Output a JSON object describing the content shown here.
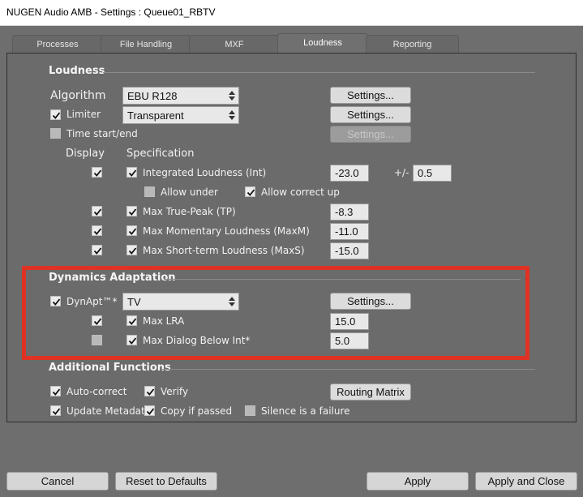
{
  "window": {
    "title": "NUGEN Audio AMB - Settings : Queue01_RBTV"
  },
  "tabs": [
    {
      "label": "Processes",
      "active": false
    },
    {
      "label": "File Handling",
      "active": false
    },
    {
      "label": "MXF",
      "active": false
    },
    {
      "label": "Loudness",
      "active": true
    },
    {
      "label": "Reporting",
      "active": false
    }
  ],
  "loudness": {
    "heading": "Loudness",
    "algorithm_label": "Algorithm",
    "algorithm_value": "EBU R128",
    "limiter_label": "Limiter",
    "limiter_checked": true,
    "limiter_value": "Transparent",
    "time_label": "Time start/end",
    "time_checked": false,
    "settings_label": "Settings...",
    "display_header": "Display",
    "spec_header": "Specification",
    "integrated": {
      "label": "Integrated Loudness (Int)",
      "value": "-23.0",
      "tol_label": "+/-",
      "tol_value": "0.5"
    },
    "allow_under_label": "Allow under",
    "allow_under_checked": false,
    "allow_correct_up_label": "Allow correct up",
    "allow_correct_up_checked": true,
    "true_peak": {
      "label": "Max True-Peak (TP)",
      "value": "-8.3"
    },
    "momentary": {
      "label": "Max Momentary Loudness (MaxM)",
      "value": "-11.0"
    },
    "short_term": {
      "label": "Max Short-term Loudness (MaxS)",
      "value": "-15.0"
    }
  },
  "dynamics": {
    "heading": "Dynamics Adaptation",
    "dynapt_label": "DynApt™*",
    "dynapt_checked": true,
    "dynapt_value": "TV",
    "settings_label": "Settings...",
    "max_lra": {
      "label": "Max LRA",
      "value": "15.0",
      "display_checked": true,
      "spec_checked": true
    },
    "max_dialog": {
      "label": "Max Dialog Below Int*",
      "value": "5.0",
      "display_checked": false,
      "spec_checked": true
    }
  },
  "additional": {
    "heading": "Additional Functions",
    "auto_correct": {
      "label": "Auto-correct",
      "checked": true
    },
    "verify": {
      "label": "Verify",
      "checked": true
    },
    "update_metadata": {
      "label": "Update Metadata",
      "checked": true
    },
    "copy_if_passed": {
      "label": "Copy if passed",
      "checked": true
    },
    "silence_failure": {
      "label": "Silence is a failure",
      "checked": false
    },
    "routing_matrix_label": "Routing Matrix"
  },
  "footer": {
    "cancel": "Cancel",
    "reset": "Reset to Defaults",
    "apply": "Apply",
    "apply_close": "Apply and Close"
  },
  "colors": {
    "highlight_box": "#e03224",
    "panel_bg": "#6b6b6b"
  }
}
